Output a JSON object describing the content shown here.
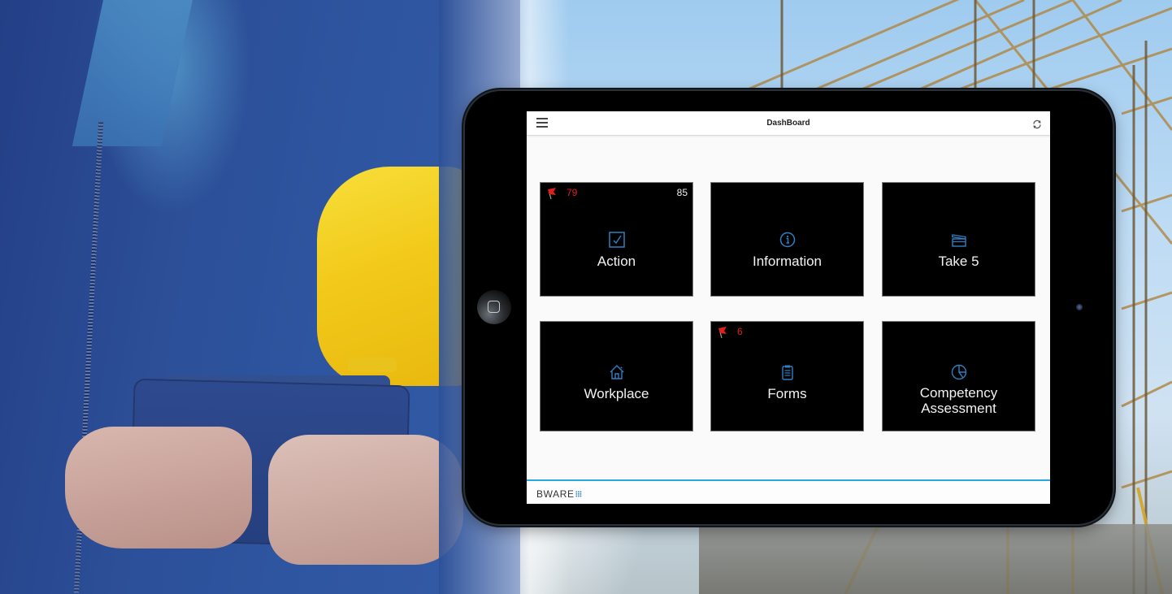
{
  "app": {
    "title": "DashBoard",
    "menu_icon": "hamburger-menu-icon",
    "refresh_icon": "refresh-icon",
    "accent_color": "#29a8e0",
    "icon_color": "#2f7fc0",
    "alert_color": "#e0201c"
  },
  "tiles": [
    {
      "label": "Action",
      "icon": "checkbox-icon",
      "flag_count": "79",
      "total_count": "85"
    },
    {
      "label": "Information",
      "icon": "info-icon"
    },
    {
      "label": "Take 5",
      "icon": "clapperboard-icon"
    },
    {
      "label": "Workplace",
      "icon": "home-icon"
    },
    {
      "label": "Forms",
      "icon": "clipboard-icon",
      "flag_count": "6"
    },
    {
      "label_line1": "Competency",
      "label_line2": "Assessment",
      "icon": "pie-chart-icon"
    }
  ],
  "footer": {
    "brand": "BWARE"
  }
}
